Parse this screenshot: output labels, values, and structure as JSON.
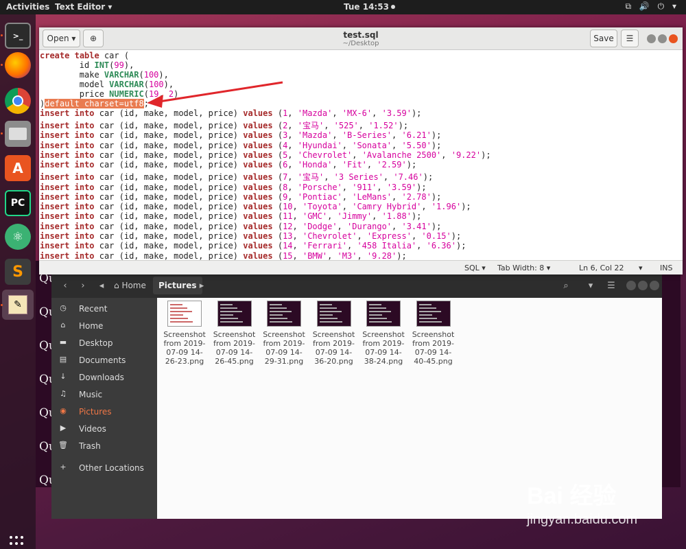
{
  "topbar": {
    "activities": "Activities",
    "app_menu": "Text Editor ▾",
    "clock": "Tue 14:53",
    "tray": "⧉ 🔊 ⏻ ▾"
  },
  "dock": {
    "icons": [
      "terminal-icon",
      "firefox-icon",
      "chrome-icon",
      "files-icon",
      "software-icon",
      "pycharm-icon",
      "atom-icon",
      "sublime-icon",
      "text-editor-icon"
    ]
  },
  "terminal_lines": [
    "Qu",
    "Qu",
    "Qu",
    "Qu",
    "Qu",
    "Qu",
    "Qu"
  ],
  "editor": {
    "open_label": "Open",
    "title": "test.sql",
    "subtitle": "~/Desktop",
    "save_label": "Save",
    "status": {
      "lang": "SQL ▾",
      "tab": "Tab Width: 8 ▾",
      "pos": "Ln 6, Col 22",
      "ins": "INS"
    },
    "highlight_text": "default charset=utf8",
    "lines": [
      {
        "kind": "create",
        "text": "car ("
      },
      {
        "kind": "col",
        "name": "id",
        "type": "INT",
        "args": "99",
        "tail": "),"
      },
      {
        "kind": "col",
        "name": "make",
        "type": "VARCHAR",
        "args": "100",
        "tail": "),"
      },
      {
        "kind": "col",
        "name": "model",
        "type": "VARCHAR",
        "args": "100",
        "tail": "),"
      },
      {
        "kind": "col",
        "name": "price",
        "type": "NUMERIC",
        "args": "19, 2",
        "tail": ")"
      }
    ],
    "rows": [
      [
        "1",
        "'Mazda'",
        "'MX-6'",
        "'3.59'"
      ],
      [
        "2",
        "'宝马'",
        "'525'",
        "'1.52'"
      ],
      [
        "3",
        "'Mazda'",
        "'B-Series'",
        "'6.21'"
      ],
      [
        "4",
        "'Hyundai'",
        "'Sonata'",
        "'5.50'"
      ],
      [
        "5",
        "'Chevrolet'",
        "'Avalanche 2500'",
        "'9.22'"
      ],
      [
        "6",
        "'Honda'",
        "'Fit'",
        "'2.59'"
      ],
      [
        "7",
        "'宝马'",
        "'3 Series'",
        "'7.46'"
      ],
      [
        "8",
        "'Porsche'",
        "'911'",
        "'3.59'"
      ],
      [
        "9",
        "'Pontiac'",
        "'LeMans'",
        "'2.78'"
      ],
      [
        "10",
        "'Toyota'",
        "'Camry Hybrid'",
        "'1.96'"
      ],
      [
        "11",
        "'GMC'",
        "'Jimmy'",
        "'1.88'"
      ],
      [
        "12",
        "'Dodge'",
        "'Durango'",
        "'3.41'"
      ],
      [
        "13",
        "'Chevrolet'",
        "'Express'",
        "'0.15'"
      ],
      [
        "14",
        "'Ferrari'",
        "'458 Italia'",
        "'6.36'"
      ],
      [
        "15",
        "'BMW'",
        "'M3'",
        "'9.28'"
      ]
    ]
  },
  "files": {
    "path_home": "Home",
    "path_current": "Pictures",
    "sidebar": [
      {
        "icon": "◷",
        "label": "Recent",
        "name": "clock-icon"
      },
      {
        "icon": "⌂",
        "label": "Home",
        "name": "home-icon"
      },
      {
        "icon": "▬",
        "label": "Desktop",
        "name": "folder-icon"
      },
      {
        "icon": "▤",
        "label": "Documents",
        "name": "document-icon"
      },
      {
        "icon": "↓",
        "label": "Downloads",
        "name": "download-icon"
      },
      {
        "icon": "♫",
        "label": "Music",
        "name": "music-icon"
      },
      {
        "icon": "◉",
        "label": "Pictures",
        "name": "camera-icon"
      },
      {
        "icon": "▶",
        "label": "Videos",
        "name": "video-icon"
      },
      {
        "icon": "🗑",
        "label": "Trash",
        "name": "trash-icon"
      },
      {
        "icon": "+",
        "label": "Other Locations",
        "name": "plus-icon"
      }
    ],
    "thumbs": [
      {
        "caption": "Screenshot from 2019-07-09 14-26-23.png",
        "light": true
      },
      {
        "caption": "Screenshot from 2019-07-09 14-26-45.png",
        "light": false
      },
      {
        "caption": "Screenshot from 2019-07-09 14-29-31.png",
        "light": false
      },
      {
        "caption": "Screenshot from 2019-07-09 14-36-20.png",
        "light": false
      },
      {
        "caption": "Screenshot from 2019-07-09 14-38-24.png",
        "light": false
      },
      {
        "caption": "Screenshot from 2019-07-09 14-40-45.png",
        "light": false
      }
    ]
  },
  "watermark": {
    "big": "Bai 经验",
    "small": "jingyan.baidu.com"
  }
}
